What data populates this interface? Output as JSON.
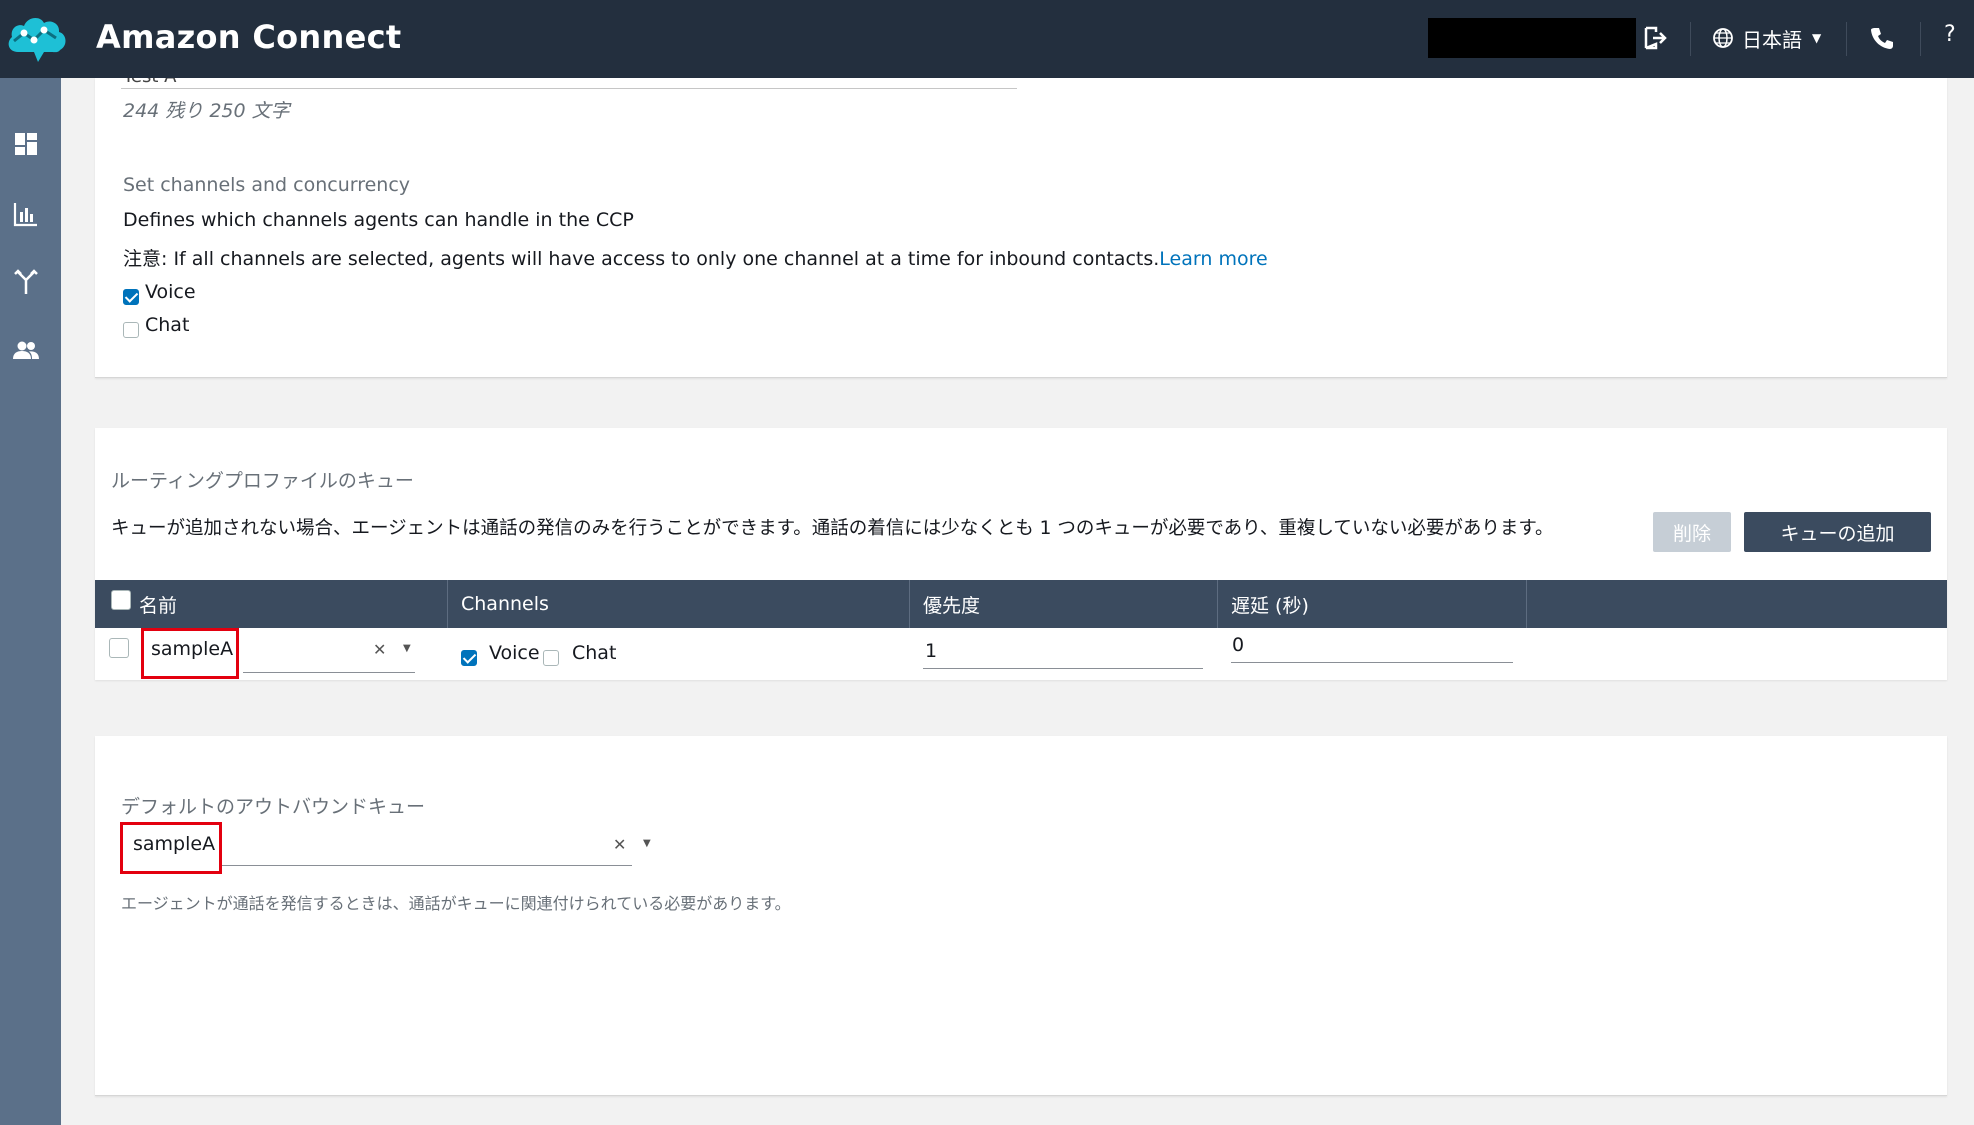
{
  "header": {
    "app_title": "Amazon Connect",
    "language": "日本語",
    "help": "?"
  },
  "sidebar": {
    "items": [
      {
        "icon": "dashboard-icon"
      },
      {
        "icon": "metrics-icon"
      },
      {
        "icon": "routing-icon"
      },
      {
        "icon": "users-icon"
      }
    ]
  },
  "description_field": {
    "clipped_value": "Test A",
    "char_count": "244 残り 250 文字"
  },
  "channels": {
    "label": "Set channels and concurrency",
    "description": "Defines which channels agents can handle in the CCP",
    "note_prefix": "注意:",
    "note": " If all channels are selected, agents will have access to only one channel at a time for inbound contacts.",
    "learn_more": "Learn more",
    "voice_label": "Voice",
    "voice_checked": true,
    "chat_label": "Chat",
    "chat_checked": false
  },
  "queues": {
    "title": "ルーティングプロファイルのキュー",
    "description": "キューが追加されない場合、エージェントは通話の発信のみを行うことができます。通話の着信には少なくとも 1 つのキューが必要であり、重複していない必要があります。",
    "delete_button": "削除",
    "add_button": "キューの追加",
    "columns": [
      "名前",
      "Channels",
      "優先度",
      "遅延 (秒)"
    ],
    "rows": [
      {
        "name": "sampleA",
        "voice_label": "Voice",
        "voice_checked": true,
        "chat_label": "Chat",
        "chat_checked": false,
        "priority": "1",
        "delay": "0"
      }
    ]
  },
  "outbound": {
    "title": "デフォルトのアウトバウンドキュー",
    "value": "sampleA",
    "help": "エージェントが通話を発信するときは、通話がキューに関連付けられている必要があります。"
  },
  "colors": {
    "topbar": "#232f3e",
    "sidebar": "#5b7089",
    "table_header": "#3b4b5f",
    "link": "#0073bb",
    "highlight": "#e3000f"
  }
}
